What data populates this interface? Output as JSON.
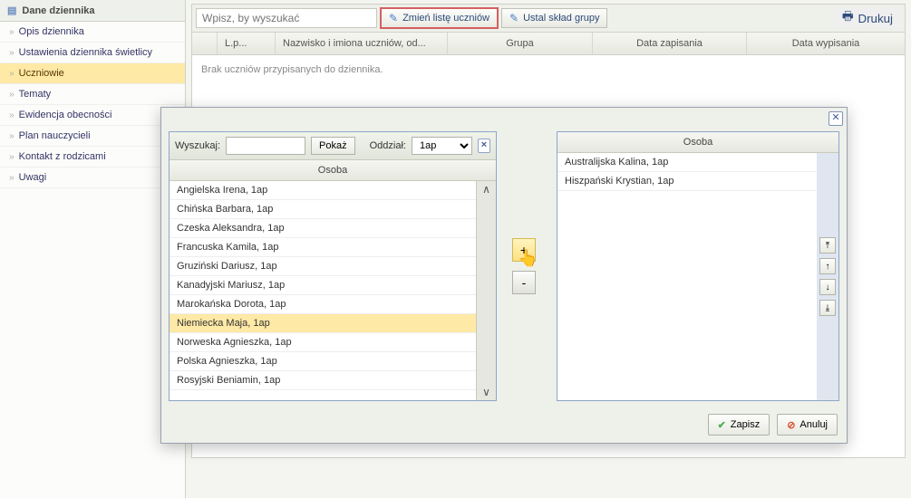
{
  "sidebar": {
    "title": "Dane dziennika",
    "items": [
      {
        "label": "Opis dziennika"
      },
      {
        "label": "Ustawienia dziennika świetlicy"
      },
      {
        "label": "Uczniowie"
      },
      {
        "label": "Tematy"
      },
      {
        "label": "Ewidencja obecności"
      },
      {
        "label": "Plan nauczycieli"
      },
      {
        "label": "Kontakt z rodzicami"
      },
      {
        "label": "Uwagi"
      }
    ],
    "active_index": 2
  },
  "toolbar": {
    "search_placeholder": "Wpisz, by wyszukać",
    "change_list_label": "Zmień listę uczniów",
    "set_group_label": "Ustal skład grupy",
    "print_label": "Drukuj"
  },
  "grid": {
    "columns": [
      "L.p...",
      "Nazwisko i imiona uczniów, od...",
      "Grupa",
      "Data zapisania",
      "Data wypisania"
    ],
    "empty_text": "Brak uczniów przypisanych do dziennika."
  },
  "modal": {
    "search_label": "Wyszukaj:",
    "show_btn": "Pokaż",
    "dept_label": "Oddział:",
    "dept_value": "1ap",
    "left_header": "Osoba",
    "right_header": "Osoba",
    "left_list": [
      "Angielska Irena, 1ap",
      "Chińska Barbara, 1ap",
      "Czeska Aleksandra, 1ap",
      "Francuska Kamila, 1ap",
      "Gruziński Dariusz, 1ap",
      "Kanadyjski Mariusz, 1ap",
      "Marokańska Dorota, 1ap",
      "Niemiecka Maja, 1ap",
      "Norweska Agnieszka, 1ap",
      "Polska Agnieszka, 1ap",
      "Rosyjski Beniamin, 1ap"
    ],
    "left_selected_index": 7,
    "right_list": [
      "Australijska Kalina, 1ap",
      "Hiszpański Krystian, 1ap"
    ],
    "save_btn": "Zapisz",
    "cancel_btn": "Anuluj",
    "plus": "+",
    "minus": "-"
  }
}
